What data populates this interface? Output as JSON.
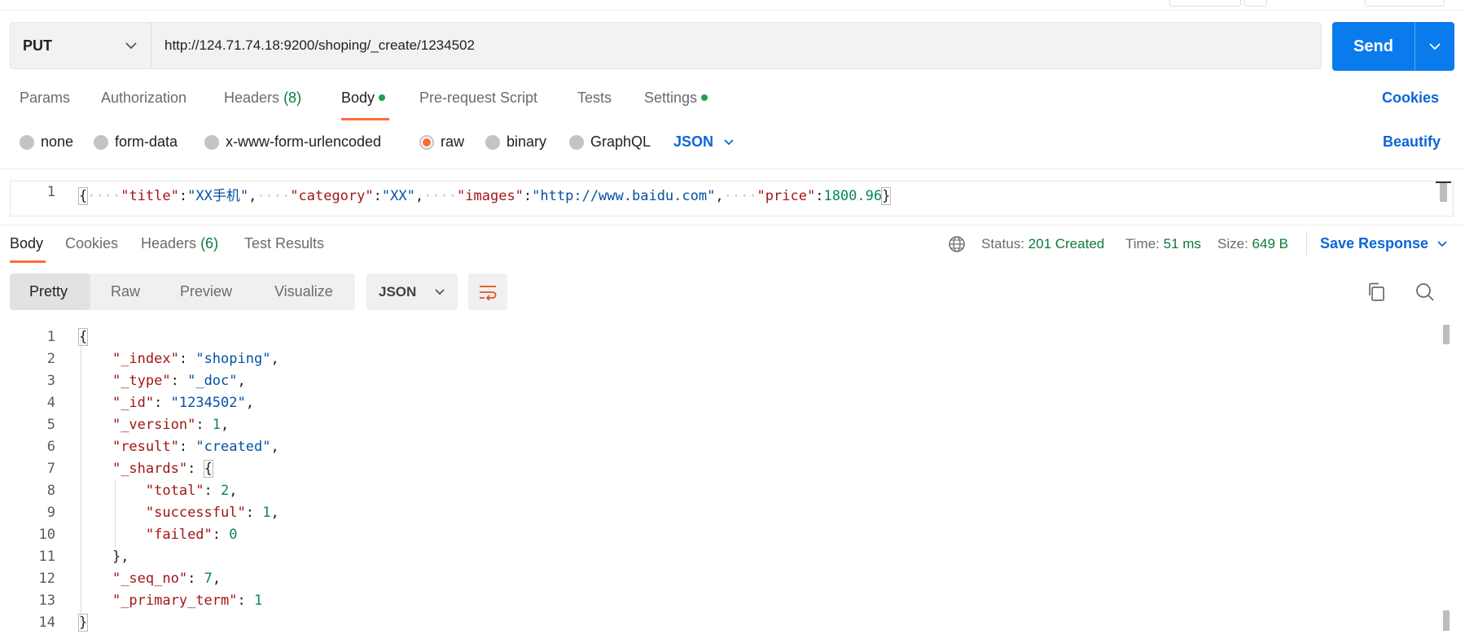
{
  "request": {
    "method": "PUT",
    "url": "http://124.71.74.18:9200/shoping/_create/1234502",
    "send_label": "Send"
  },
  "request_tabs": {
    "params": "Params",
    "authorization": "Authorization",
    "headers": "Headers",
    "headers_count": "(8)",
    "body": "Body",
    "prerequest": "Pre-request Script",
    "tests": "Tests",
    "settings": "Settings",
    "cookies": "Cookies"
  },
  "body_types": {
    "none": "none",
    "form_data": "form-data",
    "urlencoded": "x-www-form-urlencoded",
    "raw": "raw",
    "binary": "binary",
    "graphql": "GraphQL",
    "format": "JSON",
    "beautify": "Beautify",
    "selected": "raw"
  },
  "request_body": {
    "line_number": "1",
    "open": "{",
    "k1": "\"title\"",
    "v1": "\"XX手机\"",
    "k2": "\"category\"",
    "v2": "\"XX\"",
    "k3": "\"images\"",
    "v3": "\"http://www.baidu.com\"",
    "k4": "\"price\"",
    "v4": "1800.96",
    "close": "}"
  },
  "response_tabs": {
    "body": "Body",
    "cookies": "Cookies",
    "headers": "Headers",
    "headers_count": "(6)",
    "test_results": "Test Results"
  },
  "response_status": {
    "status_label": "Status:",
    "status_value": "201 Created",
    "time_label": "Time:",
    "time_value": "51 ms",
    "size_label": "Size:",
    "size_value": "649 B",
    "save_response": "Save Response"
  },
  "view_modes": {
    "pretty": "Pretty",
    "raw": "Raw",
    "preview": "Preview",
    "visualize": "Visualize",
    "format": "JSON",
    "active": "Pretty"
  },
  "response_body": {
    "line_numbers": [
      "1",
      "2",
      "3",
      "4",
      "5",
      "6",
      "7",
      "8",
      "9",
      "10",
      "11",
      "12",
      "13",
      "14"
    ],
    "open": "{",
    "k_index": "\"_index\"",
    "v_index": "\"shoping\"",
    "k_type": "\"_type\"",
    "v_type": "\"_doc\"",
    "k_id": "\"_id\"",
    "v_id": "\"1234502\"",
    "k_version": "\"_version\"",
    "v_version": "1",
    "k_result": "\"result\"",
    "v_result": "\"created\"",
    "k_shards": "\"_shards\"",
    "k_total": "\"total\"",
    "v_total": "2",
    "k_successful": "\"successful\"",
    "v_successful": "1",
    "k_failed": "\"failed\"",
    "v_failed": "0",
    "shards_close": "},",
    "k_seq": "\"_seq_no\"",
    "v_seq": "7",
    "k_primary": "\"_primary_term\"",
    "v_primary": "1",
    "close": "}"
  },
  "colors": {
    "accent_orange": "#ff6c37",
    "send_blue": "#097bed",
    "link_blue": "#0c66d6",
    "status_green": "#0c7a3e",
    "dot_green": "#1fa24b"
  },
  "icons": {
    "method_dropdown": "chevron-down-icon",
    "send_dropdown": "chevron-down-icon",
    "format_dropdown": "chevron-down-icon",
    "globe": "globe-icon",
    "wrap": "wrap-lines-icon",
    "copy": "copy-icon",
    "search": "search-icon"
  }
}
